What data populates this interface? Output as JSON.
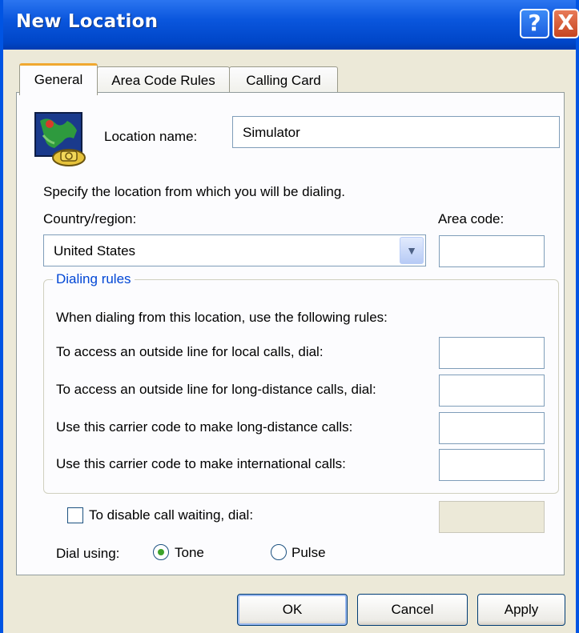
{
  "window": {
    "title": "New Location",
    "help_label": "?",
    "close_label": "X"
  },
  "tabs": [
    {
      "label": "General",
      "active": true
    },
    {
      "label": "Area Code Rules",
      "active": false
    },
    {
      "label": "Calling Card",
      "active": false
    }
  ],
  "location": {
    "label": "Location name:",
    "value": "Simulator",
    "icon": "map-phone-icon"
  },
  "instructions": "Specify the location from which you will be dialing.",
  "country": {
    "label": "Country/region:",
    "value": "United States"
  },
  "area_code": {
    "label": "Area code:",
    "value": ""
  },
  "dialing_rules": {
    "title": "Dialing rules",
    "intro": "When dialing from this location, use the following rules:",
    "rules": [
      {
        "label": "To access an outside line for local calls, dial:",
        "value": ""
      },
      {
        "label": "To access an outside line for long-distance calls, dial:",
        "value": ""
      },
      {
        "label": "Use this carrier code to make long-distance calls:",
        "value": ""
      },
      {
        "label": "Use this carrier code to make international calls:",
        "value": ""
      }
    ]
  },
  "call_waiting": {
    "label": "To disable call waiting, dial:",
    "checked": false,
    "value": ""
  },
  "dial_using": {
    "label": "Dial using:",
    "tone_label": "Tone",
    "pulse_label": "Pulse",
    "selected": "Tone"
  },
  "buttons": {
    "ok": "OK",
    "cancel": "Cancel",
    "apply": "Apply"
  },
  "colors": {
    "titlebar": "#0054e3",
    "accent": "#0046d5",
    "tab_highlight": "#f0a830",
    "radio_selected": "#3ca22a"
  }
}
